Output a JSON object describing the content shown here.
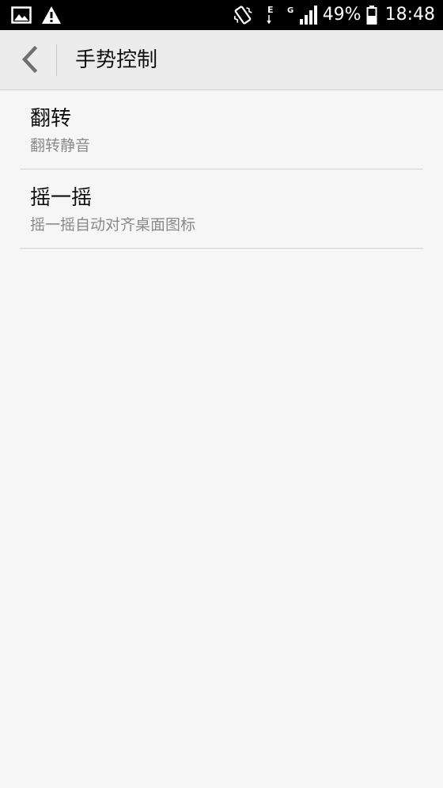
{
  "status_bar": {
    "left_icons": [
      "image-icon",
      "warning-icon"
    ],
    "right_icons": [
      "vibrate-icon",
      "network-e-icon",
      "network-g-icon",
      "signal-icon",
      "battery-icon"
    ],
    "battery_text": "49%",
    "time": "18:48",
    "network_letter_e": "E",
    "network_letter_g": "G"
  },
  "action_bar": {
    "back_icon": "chevron-left-icon",
    "title": "手势控制"
  },
  "list": {
    "items": [
      {
        "title": "翻转",
        "subtitle": "翻转静音"
      },
      {
        "title": "摇一摇",
        "subtitle": "摇一摇自动对齐桌面图标"
      }
    ]
  }
}
